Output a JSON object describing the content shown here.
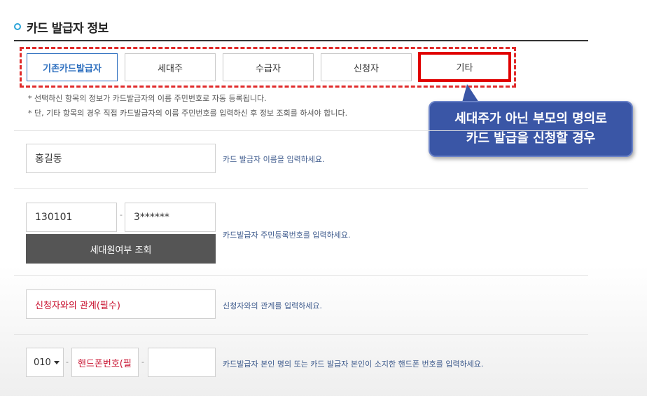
{
  "section": {
    "title": "카드 발급자 정보"
  },
  "tabs": [
    {
      "label": "기존카드발급자"
    },
    {
      "label": "세대주"
    },
    {
      "label": "수급자"
    },
    {
      "label": "신청자"
    },
    {
      "label": "기타"
    }
  ],
  "notes": [
    "* 선택하신 항목의 정보가 카드발급자의 이름 주민번호로 자동 등록됩니다.",
    "* 단, 기타 항목의 경우 직접 카드발급자의 이름 주민번호를 입력하신 후 정보 조회를 하셔야 합니다."
  ],
  "callout": {
    "line1": "세대주가 아닌 부모의 명의로",
    "line2": "카드 발급을 신청할 경우"
  },
  "name_row": {
    "value": "홍길동",
    "help": "카드 발급자 이름을 입력하세요."
  },
  "rrn_row": {
    "front": "130101",
    "dash": "-",
    "back": "3******",
    "lookup_label": "세대원여부 조회",
    "help": "카드발급자 주민등록번호를 입력하세요."
  },
  "relation_row": {
    "placeholder": "신청자와의 관계(필수)",
    "help": "신청자와의 관계를 입력하세요."
  },
  "phone_row": {
    "prefix": "010",
    "dash": "-",
    "middle_placeholder": "핸드폰번호(필",
    "last": "",
    "help": "카드발급자 본인 명의 또는 카드 발급자 본인이 소지한 핸드폰 번호를 입력하세요."
  },
  "colors": {
    "accent": "#2d6fbf",
    "highlight": "#e00000",
    "callout_bg": "#3a56a6",
    "required_text": "#c8102e"
  }
}
